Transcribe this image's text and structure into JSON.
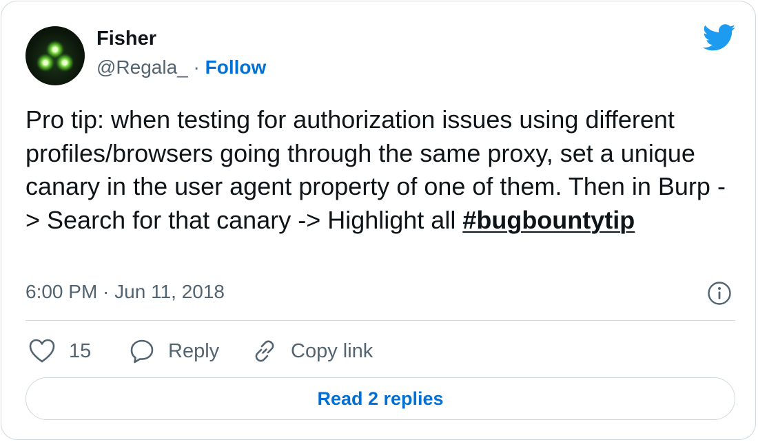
{
  "author": {
    "name": "Fisher",
    "handle": "@Regala_",
    "separator": "·",
    "follow_label": "Follow",
    "avatar_icon": "three-green-lights-avatar"
  },
  "brand": {
    "icon": "twitter-bird-icon",
    "color": "#1d9bf0"
  },
  "tweet": {
    "text": "Pro tip: when testing for authorization issues using different profiles/browsers going through the same proxy, set a unique canary in the user agent property of one of them. Then in Burp -> Search for that canary -> Highlight all ",
    "hashtag": "#bugbountytip"
  },
  "meta": {
    "timestamp": "6:00 PM · Jun 11, 2018",
    "info_icon": "info-icon"
  },
  "actions": {
    "like_count": "15",
    "reply_label": "Reply",
    "copy_label": "Copy link"
  },
  "replies_button": "Read 2 replies",
  "colors": {
    "link_blue": "#006fd6",
    "muted_text": "#536471",
    "border": "#cfd9de",
    "text": "#0f1419"
  }
}
